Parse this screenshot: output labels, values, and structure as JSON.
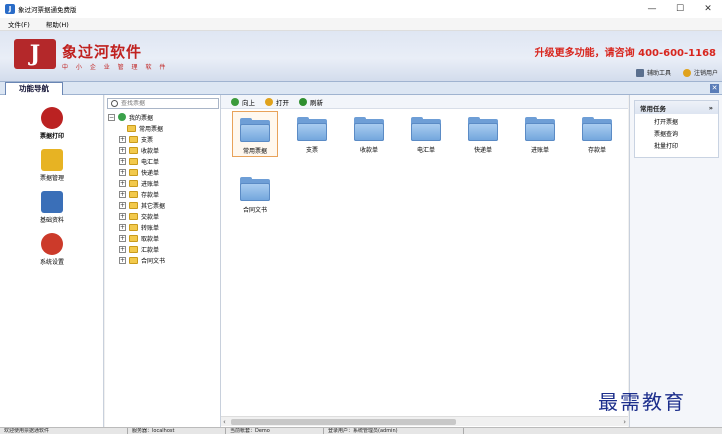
{
  "window": {
    "title": "象过河票据通免费版",
    "minimize": "—",
    "maximize": "☐",
    "close": "✕"
  },
  "menu": [
    "文件(F)",
    "帮助(H)"
  ],
  "banner": {
    "logo_mark": "J",
    "brand": "象过河软件",
    "tagline": "中 小 企 业 管 理 软 件",
    "promo": "升级更多功能，请咨询 400-600-1168",
    "tools": [
      {
        "label": "辅助工具",
        "icon": "tools-icon"
      },
      {
        "label": "注销用户",
        "icon": "user-icon"
      }
    ]
  },
  "panel": {
    "tab": "功能导航",
    "close": "✕"
  },
  "nav": [
    {
      "label": "票据打印",
      "icon": "printer-icon",
      "color": "#b22",
      "active": true
    },
    {
      "label": "票据管理",
      "icon": "document-icon",
      "color": "#e7b323"
    },
    {
      "label": "基础资料",
      "icon": "checklist-icon",
      "color": "#3a6fb8"
    },
    {
      "label": "系统设置",
      "icon": "wrench-icon",
      "color": "#cc3a2a"
    }
  ],
  "tree": {
    "search_placeholder": "查找票据",
    "root": "我的票据",
    "nodes": [
      "常用票据",
      "支票",
      "收款单",
      "电汇单",
      "快递单",
      "进账单",
      "存款单",
      "其它票据",
      "交款单",
      "转账单",
      "取款单",
      "汇款单",
      "合同文书"
    ]
  },
  "toolbar": [
    {
      "label": "向上",
      "icon": "up-icon",
      "color": "#3c9b3c"
    },
    {
      "label": "打开",
      "icon": "open-icon",
      "color": "#e0a21c"
    },
    {
      "label": "刷新",
      "icon": "refresh-icon",
      "color": "#2f8f2f"
    }
  ],
  "folders": [
    "常用票据",
    "支票",
    "收款单",
    "电汇单",
    "快递单",
    "进账单",
    "存款单",
    "合同文书"
  ],
  "tasks": {
    "title": "常用任务",
    "collapse": "»",
    "links": [
      "打开票据",
      "票据查询",
      "批量打印"
    ]
  },
  "statusbar": [
    "欢迎使用票据通软件",
    "服务器：localhost",
    "当前帐套：Demo",
    "登录用户：系统管理员(admin)"
  ],
  "watermark": "最需教育"
}
